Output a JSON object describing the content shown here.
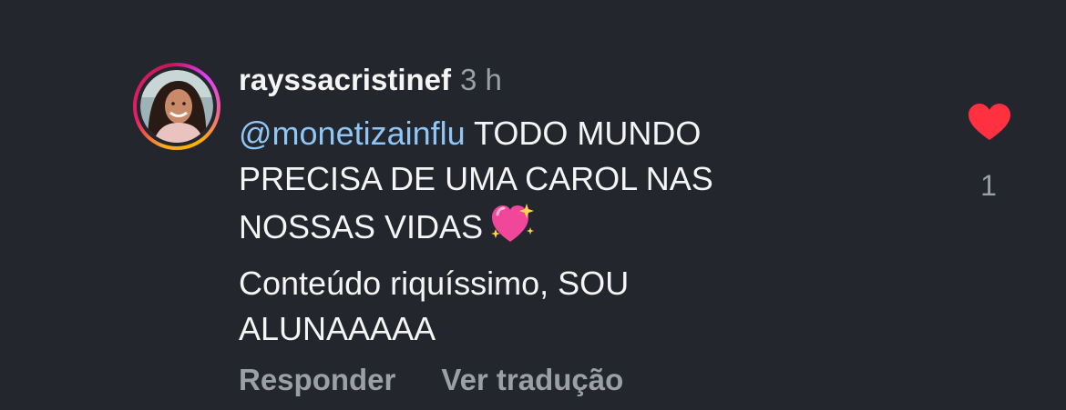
{
  "comment": {
    "username": "rayssacristinef",
    "timestamp": "3 h",
    "mention": "@monetizainflu",
    "text_part1": " TODO MUNDO PRECISA DE UMA CAROL NAS NOSSAS VIDAS",
    "emoji": "sparkling-heart-emoji",
    "text_part2": "Conteúdo riquíssimo, SOU ALUNAAAAA",
    "reply_label": "Responder",
    "translate_label": "Ver tradução",
    "like_count": "1",
    "liked": true
  },
  "colors": {
    "background": "#23262c",
    "text": "#f5f5f5",
    "muted": "#9aa0a8",
    "mention": "#8fc6f5",
    "like": "#ff3040"
  }
}
